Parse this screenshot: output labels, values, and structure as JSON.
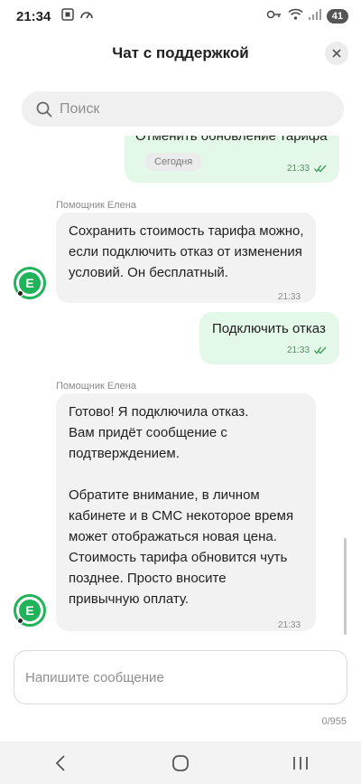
{
  "status_bar": {
    "time": "21:34",
    "battery": "41"
  },
  "header": {
    "title": "Чат с поддержкой"
  },
  "search": {
    "placeholder": "Поиск"
  },
  "date_divider": "Сегодня",
  "messages": [
    {
      "direction": "out",
      "text": "Отменить обновление тарифа",
      "time": "21:33"
    },
    {
      "direction": "in",
      "sender": "Помощник Елена",
      "text": "Сохранить стоимость тарифа можно, если подключить отказ от изменения условий. Он бесплатный.",
      "time": "21:33"
    },
    {
      "direction": "out",
      "text": "Подключить отказ",
      "time": "21:33"
    },
    {
      "direction": "in",
      "sender": "Помощник Елена",
      "text_lines": [
        "Готово! Я подключила отказ.",
        "Вам придёт сообщение с",
        "подтверждением.",
        "",
        "Обратите внимание, в личном",
        "кабинете и в СМС некоторое время",
        "может отображаться новая цена.",
        "Стоимость тарифа обновится чуть",
        "позднее. Просто вносите",
        "привычную оплату."
      ],
      "time": "21:33"
    }
  ],
  "avatar_letter": "E",
  "composer": {
    "placeholder": "Напишите сообщение",
    "counter": "0/955"
  },
  "colors": {
    "outgoing_bubble": "#e4f8e9",
    "incoming_bubble": "#f2f2f2",
    "accent_green": "#21b35a"
  }
}
